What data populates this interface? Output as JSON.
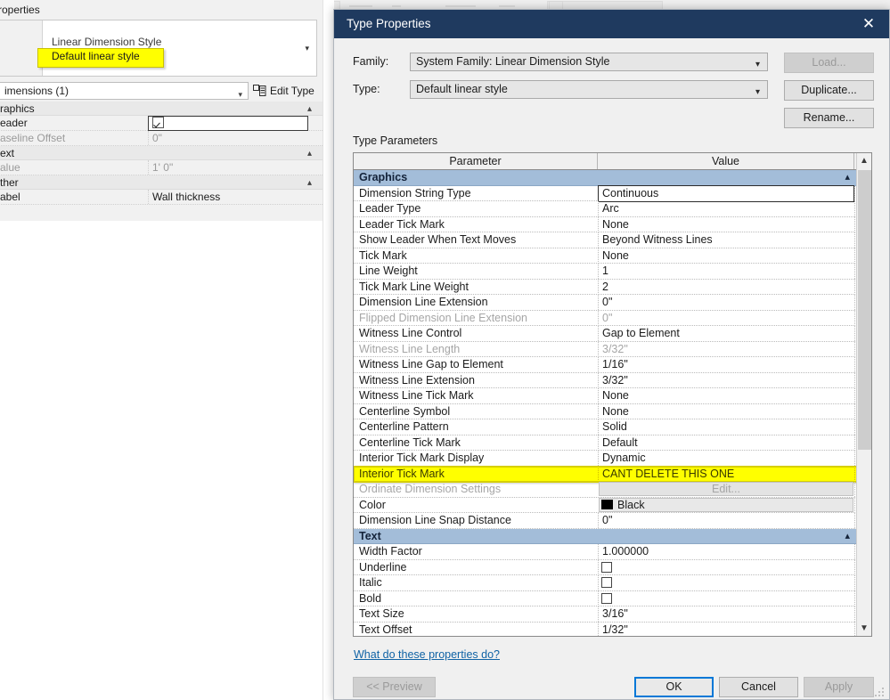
{
  "background": {
    "properties_panel": {
      "title": "roperties",
      "type_family": "Linear Dimension Style",
      "type_name": "Default linear style",
      "selector": "imensions (1)",
      "edit_type_label": "Edit Type",
      "highlight_color": "#ffff00",
      "rows": [
        {
          "kind": "group",
          "name": "raphics"
        },
        {
          "kind": "row",
          "name": "eader",
          "value": "",
          "control": "checkbox-checked",
          "disabled": false,
          "editing": true
        },
        {
          "kind": "row",
          "name": "aseline Offset",
          "value": "0\"",
          "disabled": true
        },
        {
          "kind": "group",
          "name": "ext"
        },
        {
          "kind": "row",
          "name": "alue",
          "value": "1'  0\"",
          "disabled": true
        },
        {
          "kind": "group",
          "name": "ther"
        },
        {
          "kind": "row",
          "name": "abel",
          "value": "Wall thickness",
          "disabled": false
        }
      ]
    }
  },
  "dialog": {
    "title": "Type Properties",
    "close_icon": "close-icon",
    "family_label": "Family:",
    "family_value": "System Family: Linear Dimension Style",
    "type_label": "Type:",
    "type_value": "Default linear style",
    "load_button": "Load...",
    "duplicate_button": "Duplicate...",
    "rename_button": "Rename...",
    "type_parameters_label": "Type Parameters",
    "table": {
      "columns": [
        "Parameter",
        "Value",
        "="
      ],
      "rows": [
        {
          "kind": "group",
          "name": "Graphics"
        },
        {
          "kind": "row",
          "name": "Dimension String Type",
          "value": "Continuous",
          "state": "editing"
        },
        {
          "kind": "row",
          "name": "Leader Type",
          "value": "Arc"
        },
        {
          "kind": "row",
          "name": "Leader Tick Mark",
          "value": "None"
        },
        {
          "kind": "row",
          "name": "Show Leader When Text Moves",
          "value": "Beyond Witness Lines"
        },
        {
          "kind": "row",
          "name": "Tick Mark",
          "value": "None"
        },
        {
          "kind": "row",
          "name": "Line Weight",
          "value": "1"
        },
        {
          "kind": "row",
          "name": "Tick Mark Line Weight",
          "value": "2"
        },
        {
          "kind": "row",
          "name": "Dimension Line Extension",
          "value": "0\""
        },
        {
          "kind": "row",
          "name": "Flipped Dimension Line Extension",
          "value": "0\"",
          "state": "disabled"
        },
        {
          "kind": "row",
          "name": "Witness Line Control",
          "value": "Gap to Element"
        },
        {
          "kind": "row",
          "name": "Witness Line Length",
          "value": "3/32\"",
          "state": "disabled"
        },
        {
          "kind": "row",
          "name": "Witness Line Gap to Element",
          "value": "1/16\""
        },
        {
          "kind": "row",
          "name": "Witness Line Extension",
          "value": "3/32\""
        },
        {
          "kind": "row",
          "name": "Witness Line Tick Mark",
          "value": "None"
        },
        {
          "kind": "row",
          "name": "Centerline Symbol",
          "value": "None"
        },
        {
          "kind": "row",
          "name": "Centerline Pattern",
          "value": "Solid"
        },
        {
          "kind": "row",
          "name": "Centerline Tick Mark",
          "value": "Default"
        },
        {
          "kind": "row",
          "name": "Interior Tick Mark Display",
          "value": "Dynamic"
        },
        {
          "kind": "row",
          "name": "Interior Tick Mark",
          "value": "CANT DELETE THIS ONE",
          "state": "highlight"
        },
        {
          "kind": "row",
          "name": "Ordinate Dimension Settings",
          "value": "Edit...",
          "state": "button-disabled"
        },
        {
          "kind": "row",
          "name": "Color",
          "value": "Black",
          "state": "color",
          "swatch": "#000000"
        },
        {
          "kind": "row",
          "name": "Dimension Line Snap Distance",
          "value": "0\""
        },
        {
          "kind": "group",
          "name": "Text"
        },
        {
          "kind": "row",
          "name": "Width Factor",
          "value": "1.000000"
        },
        {
          "kind": "row",
          "name": "Underline",
          "value": "",
          "state": "checkbox"
        },
        {
          "kind": "row",
          "name": "Italic",
          "value": "",
          "state": "checkbox"
        },
        {
          "kind": "row",
          "name": "Bold",
          "value": "",
          "state": "checkbox"
        },
        {
          "kind": "row",
          "name": "Text Size",
          "value": "3/16\""
        },
        {
          "kind": "row",
          "name": "Text Offset",
          "value": "1/32\""
        }
      ]
    },
    "help_link": "What do these properties do?",
    "preview_button": "<< Preview",
    "ok_button": "OK",
    "cancel_button": "Cancel",
    "apply_button": "Apply",
    "title_bar_color": "#1f3a5f",
    "accent_color": "#0078d7"
  }
}
